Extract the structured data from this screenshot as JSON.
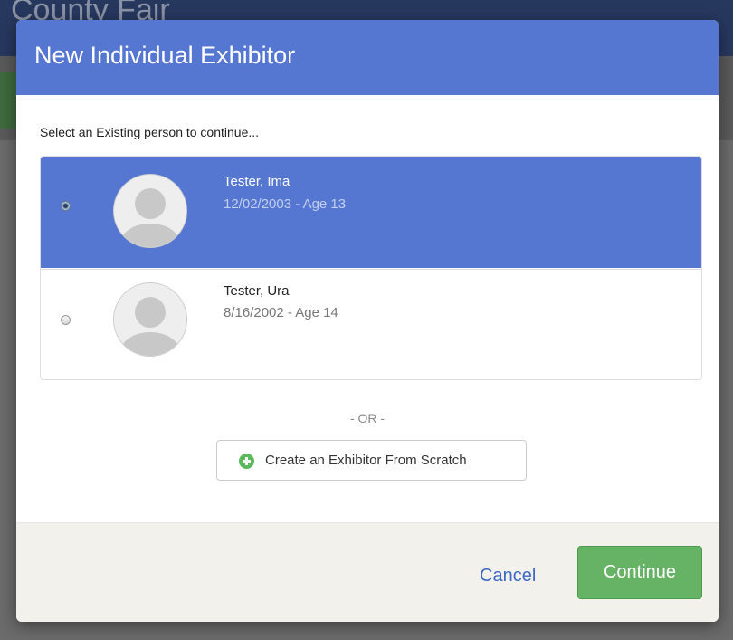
{
  "background": {
    "title": "County Fair"
  },
  "modal": {
    "title": "New Individual Exhibitor",
    "prompt": "Select an Existing person to continue...",
    "people": [
      {
        "name": "Tester, Ima",
        "dob_age": "12/02/2003 - Age 13",
        "selected": true
      },
      {
        "name": "Tester, Ura",
        "dob_age": "8/16/2002 - Age 14",
        "selected": false
      }
    ],
    "or_separator": "- OR -",
    "create_button": {
      "label": "Create an Exhibitor From Scratch",
      "icon": "plus-circle-icon"
    },
    "footer": {
      "cancel_label": "Cancel",
      "continue_label": "Continue"
    }
  },
  "colors": {
    "header_blue": "#5677d1",
    "selected_row": "#5677d1",
    "continue_green": "#66b366",
    "link_blue": "#3d68c4",
    "footer_bg": "#f3f1ec"
  }
}
